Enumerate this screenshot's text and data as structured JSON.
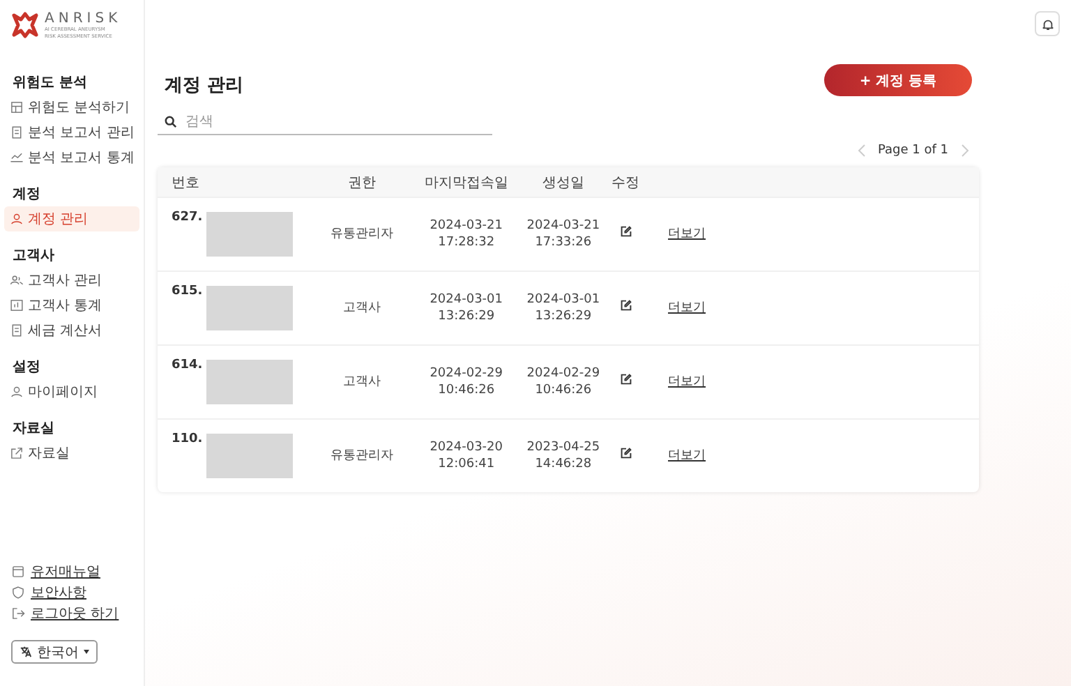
{
  "logo": {
    "name": "ANRISK",
    "tagline_1": "AI CEREBRAL ANEURYSM",
    "tagline_2": "RISK ASSESSMENT SERVICE"
  },
  "sidebar": {
    "sections": [
      {
        "title": "위험도 분석",
        "items": [
          {
            "label": "위험도 분석하기",
            "selected": false
          },
          {
            "label": "분석 보고서 관리",
            "selected": false
          },
          {
            "label": "분석 보고서 통계",
            "selected": false
          }
        ]
      },
      {
        "title": "계정",
        "items": [
          {
            "label": "계정 관리",
            "selected": true
          }
        ]
      },
      {
        "title": "고객사",
        "items": [
          {
            "label": "고객사 관리",
            "selected": false
          },
          {
            "label": "고객사 통계",
            "selected": false
          },
          {
            "label": "세금 계산서",
            "selected": false
          }
        ]
      },
      {
        "title": "설정",
        "items": [
          {
            "label": "마이페이지",
            "selected": false
          }
        ]
      },
      {
        "title": "자료실",
        "items": [
          {
            "label": "자료실",
            "selected": false
          }
        ]
      }
    ],
    "footer_links": [
      {
        "label": "유저매뉴얼"
      },
      {
        "label": "보안사항"
      },
      {
        "label": "로그아웃 하기"
      }
    ],
    "language": {
      "value": "한국어"
    }
  },
  "page": {
    "title": "계정 관리",
    "add_button": "+ 계정 등록",
    "search": {
      "placeholder": "검색"
    },
    "pagination": {
      "label": "Page 1 of 1",
      "prev_disabled": true,
      "next_disabled": true
    }
  },
  "table": {
    "columns": [
      "번호",
      "권한",
      "마지막접속일",
      "생성일",
      "수정"
    ],
    "rows": [
      {
        "number": "627.",
        "role": "유통관리자",
        "last_login": [
          "2024-03-21",
          "17:28:32"
        ],
        "created": [
          "2024-03-21",
          "17:33:26"
        ],
        "more": "더보기"
      },
      {
        "number": "615.",
        "role": "고객사",
        "last_login": [
          "2024-03-01",
          "13:26:29"
        ],
        "created": [
          "2024-03-01",
          "13:26:29"
        ],
        "more": "더보기"
      },
      {
        "number": "614.",
        "role": "고객사",
        "last_login": [
          "2024-02-29",
          "10:46:26"
        ],
        "created": [
          "2024-02-29",
          "10:46:26"
        ],
        "more": "더보기"
      },
      {
        "number": "110.",
        "role": "유통관리자",
        "last_login": [
          "2024-03-20",
          "12:06:41"
        ],
        "created": [
          "2023-04-25",
          "14:46:28"
        ],
        "more": "더보기"
      }
    ]
  }
}
